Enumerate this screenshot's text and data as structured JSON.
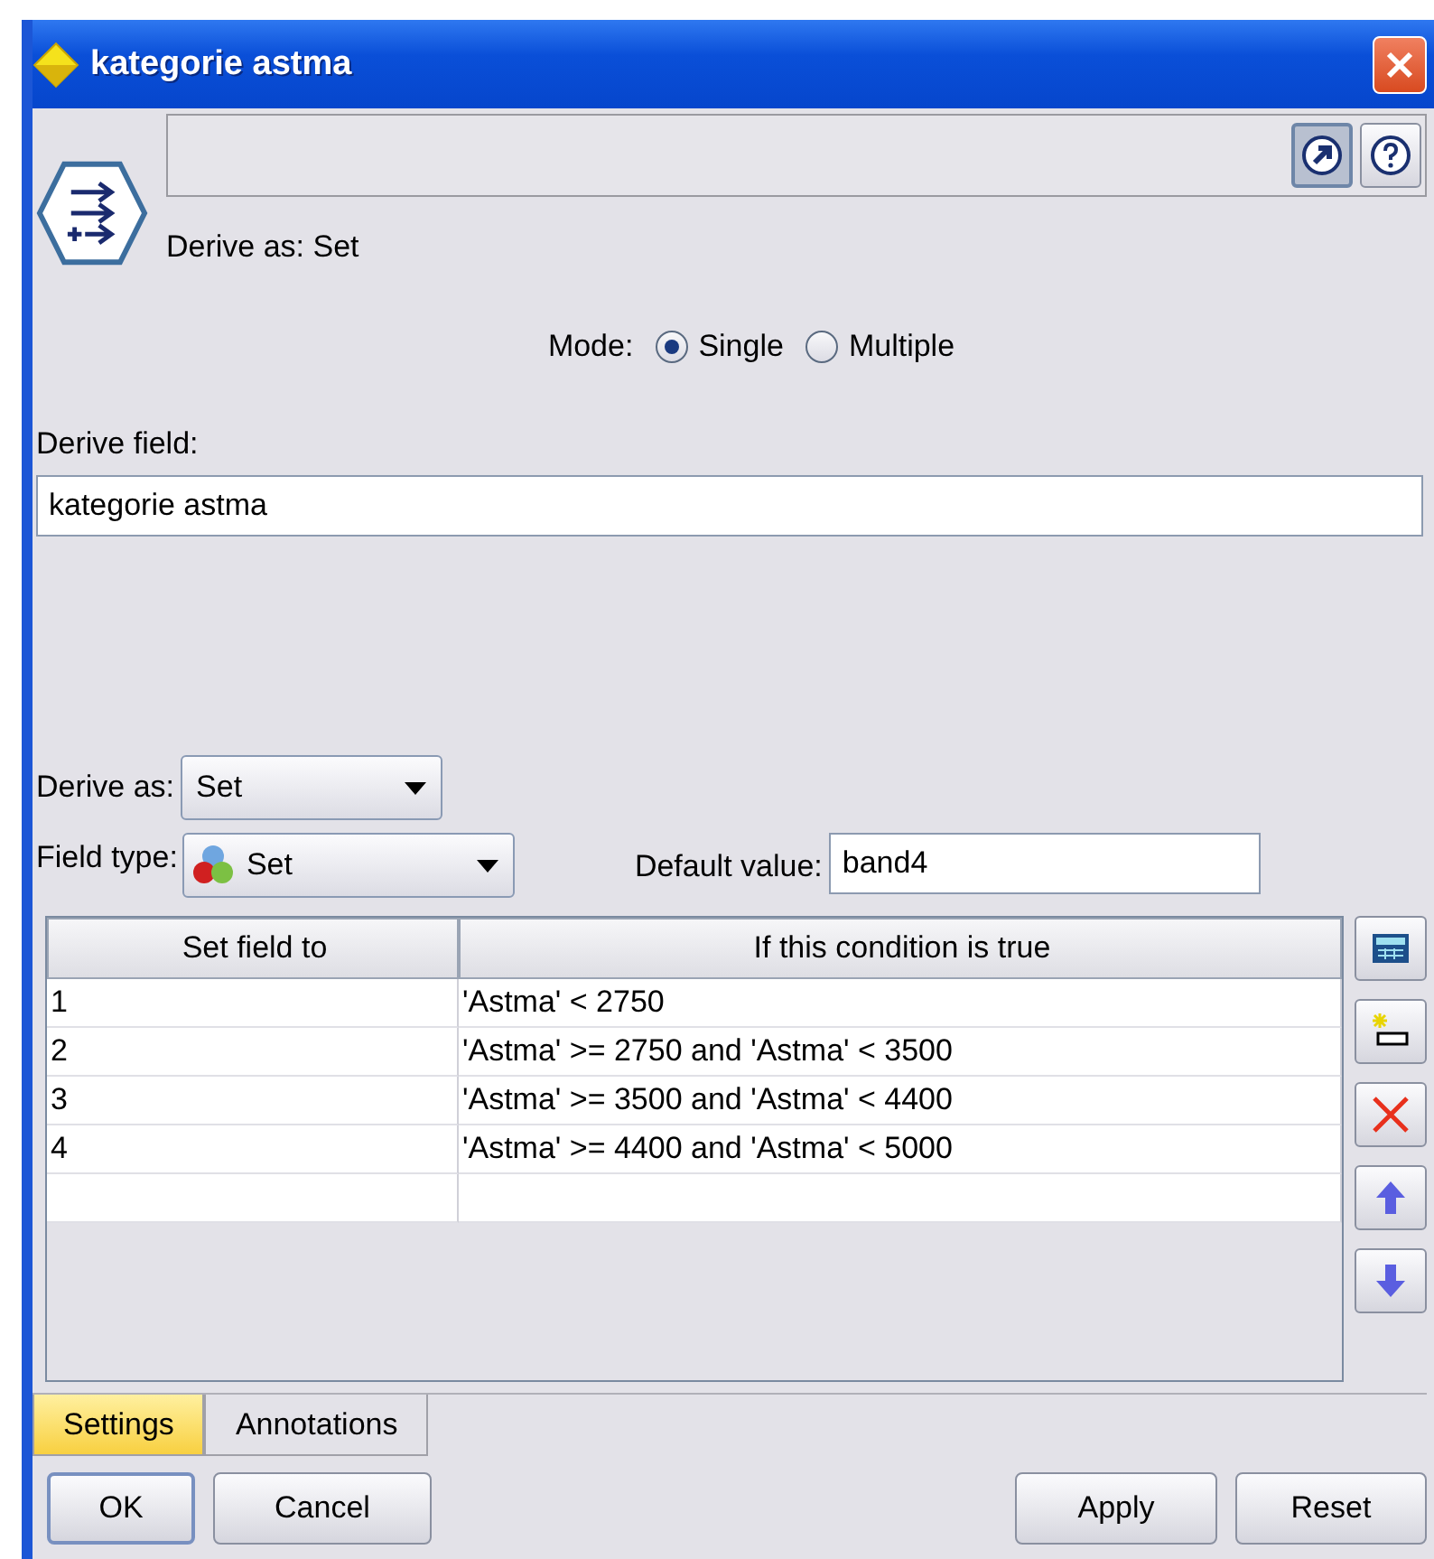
{
  "window": {
    "title": "kategorie astma"
  },
  "header": {
    "subtitle": "Derive as: Set"
  },
  "mode": {
    "label": "Mode:",
    "options": [
      {
        "label": "Single",
        "selected": true
      },
      {
        "label": "Multiple",
        "selected": false
      }
    ]
  },
  "derive_field": {
    "label": "Derive field:",
    "value": "kategorie astma"
  },
  "derive_as": {
    "label": "Derive as:",
    "value": "Set"
  },
  "field_type": {
    "label": "Field type:",
    "value": "Set"
  },
  "default_value": {
    "label": "Default value:",
    "value": "band4"
  },
  "table": {
    "columns": [
      "Set field to",
      "If this condition is true"
    ],
    "rows": [
      [
        "1",
        "'Astma' < 2750"
      ],
      [
        "2",
        "'Astma' >= 2750 and 'Astma' < 3500"
      ],
      [
        "3",
        "'Astma' >= 3500 and 'Astma' < 4400"
      ],
      [
        "4",
        "'Astma' >= 4400 and 'Astma' < 5000"
      ]
    ]
  },
  "tabs": [
    {
      "label": "Settings",
      "selected": true
    },
    {
      "label": "Annotations",
      "selected": false
    }
  ],
  "buttons_left": [
    {
      "label": "OK",
      "focused": true
    },
    {
      "label": "Cancel",
      "focused": false
    }
  ],
  "buttons_right": [
    {
      "label": "Apply",
      "focused": false
    },
    {
      "label": "Reset",
      "focused": false
    }
  ]
}
